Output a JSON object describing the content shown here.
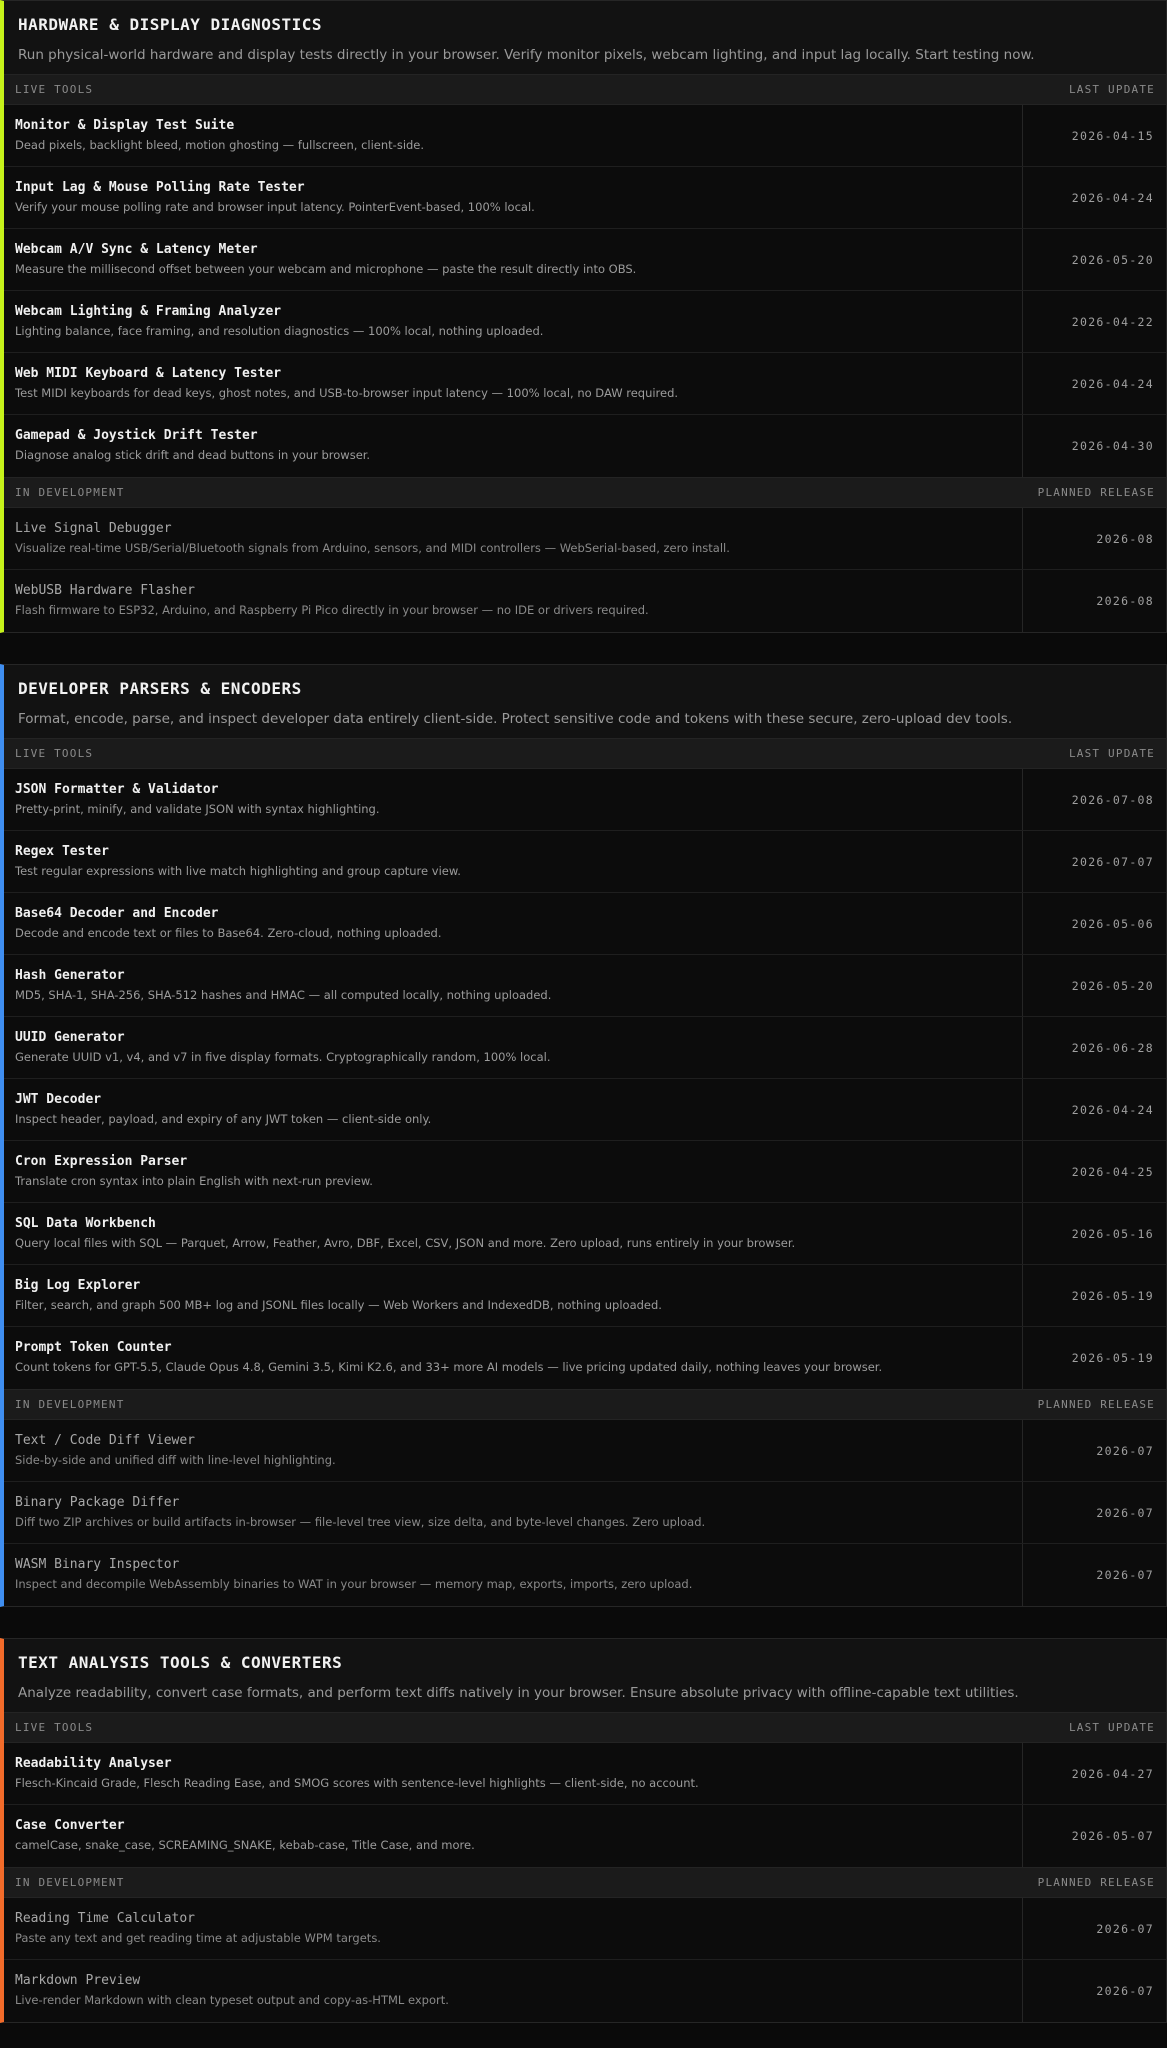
{
  "sections": [
    {
      "title": "HARDWARE & DISPLAY DIAGNOSTICS",
      "description": "Run physical-world hardware and display tests directly in your browser. Verify monitor pixels, webcam lighting, and input lag locally. Start testing now.",
      "accent": "#c6f21a",
      "live_header": {
        "left": "LIVE TOOLS",
        "right": "LAST UPDATE"
      },
      "live_tools": [
        {
          "name": "Monitor & Display Test Suite",
          "desc": "Dead pixels, backlight bleed, motion ghosting — fullscreen, client-side.",
          "date": "2026-04-15"
        },
        {
          "name": "Input Lag & Mouse Polling Rate Tester",
          "desc": "Verify your mouse polling rate and browser input latency. PointerEvent-based, 100% local.",
          "date": "2026-04-24"
        },
        {
          "name": "Webcam A/V Sync & Latency Meter",
          "desc": "Measure the millisecond offset between your webcam and microphone — paste the result directly into OBS.",
          "date": "2026-05-20"
        },
        {
          "name": "Webcam Lighting & Framing Analyzer",
          "desc": "Lighting balance, face framing, and resolution diagnostics — 100% local, nothing uploaded.",
          "date": "2026-04-22"
        },
        {
          "name": "Web MIDI Keyboard & Latency Tester",
          "desc": "Test MIDI keyboards for dead keys, ghost notes, and USB-to-browser input latency — 100% local, no DAW required.",
          "date": "2026-04-24"
        },
        {
          "name": "Gamepad & Joystick Drift Tester",
          "desc": "Diagnose analog stick drift and dead buttons in your browser.",
          "date": "2026-04-30"
        }
      ],
      "dev_header": {
        "left": "IN DEVELOPMENT",
        "right": "PLANNED RELEASE"
      },
      "dev_tools": [
        {
          "name": "Live Signal Debugger",
          "desc": "Visualize real-time USB/Serial/Bluetooth signals from Arduino, sensors, and MIDI controllers — WebSerial-based, zero install.",
          "date": "2026-08"
        },
        {
          "name": "WebUSB Hardware Flasher",
          "desc": "Flash firmware to ESP32, Arduino, and Raspberry Pi Pico directly in your browser — no IDE or drivers required.",
          "date": "2026-08"
        }
      ]
    },
    {
      "title": "DEVELOPER PARSERS & ENCODERS",
      "description": "Format, encode, parse, and inspect developer data entirely client-side. Protect sensitive code and tokens with these secure, zero-upload dev tools.",
      "accent": "#3f8ef0",
      "live_header": {
        "left": "LIVE TOOLS",
        "right": "LAST UPDATE"
      },
      "live_tools": [
        {
          "name": "JSON Formatter & Validator",
          "desc": "Pretty-print, minify, and validate JSON with syntax highlighting.",
          "date": "2026-07-08"
        },
        {
          "name": "Regex Tester",
          "desc": "Test regular expressions with live match highlighting and group capture view.",
          "date": "2026-07-07"
        },
        {
          "name": "Base64 Decoder and Encoder",
          "desc": "Decode and encode text or files to Base64. Zero-cloud, nothing uploaded.",
          "date": "2026-05-06"
        },
        {
          "name": "Hash Generator",
          "desc": "MD5, SHA-1, SHA-256, SHA-512 hashes and HMAC — all computed locally, nothing uploaded.",
          "date": "2026-05-20"
        },
        {
          "name": "UUID Generator",
          "desc": "Generate UUID v1, v4, and v7 in five display formats. Cryptographically random, 100% local.",
          "date": "2026-06-28"
        },
        {
          "name": "JWT Decoder",
          "desc": "Inspect header, payload, and expiry of any JWT token — client-side only.",
          "date": "2026-04-24"
        },
        {
          "name": "Cron Expression Parser",
          "desc": "Translate cron syntax into plain English with next-run preview.",
          "date": "2026-04-25"
        },
        {
          "name": "SQL Data Workbench",
          "desc": "Query local files with SQL — Parquet, Arrow, Feather, Avro, DBF, Excel, CSV, JSON and more. Zero upload, runs entirely in your browser.",
          "date": "2026-05-16"
        },
        {
          "name": "Big Log Explorer",
          "desc": "Filter, search, and graph 500 MB+ log and JSONL files locally — Web Workers and IndexedDB, nothing uploaded.",
          "date": "2026-05-19"
        },
        {
          "name": "Prompt Token Counter",
          "desc": "Count tokens for GPT-5.5, Claude Opus 4.8, Gemini 3.5, Kimi K2.6, and 33+ more AI models — live pricing updated daily, nothing leaves your browser.",
          "date": "2026-05-19"
        }
      ],
      "dev_header": {
        "left": "IN DEVELOPMENT",
        "right": "PLANNED RELEASE"
      },
      "dev_tools": [
        {
          "name": "Text / Code Diff Viewer",
          "desc": "Side-by-side and unified diff with line-level highlighting.",
          "date": "2026-07"
        },
        {
          "name": "Binary Package Differ",
          "desc": "Diff two ZIP archives or build artifacts in-browser — file-level tree view, size delta, and byte-level changes. Zero upload.",
          "date": "2026-07"
        },
        {
          "name": "WASM Binary Inspector",
          "desc": "Inspect and decompile WebAssembly binaries to WAT in your browser — memory map, exports, imports, zero upload.",
          "date": "2026-07"
        }
      ]
    },
    {
      "title": "TEXT ANALYSIS TOOLS & CONVERTERS",
      "description": "Analyze readability, convert case formats, and perform text diffs natively in your browser. Ensure absolute privacy with offline-capable text utilities.",
      "accent": "#f26b2a",
      "live_header": {
        "left": "LIVE TOOLS",
        "right": "LAST UPDATE"
      },
      "live_tools": [
        {
          "name": "Readability Analyser",
          "desc": "Flesch-Kincaid Grade, Flesch Reading Ease, and SMOG scores with sentence-level highlights — client-side, no account.",
          "date": "2026-04-27"
        },
        {
          "name": "Case Converter",
          "desc": "camelCase, snake_case, SCREAMING_SNAKE, kebab-case, Title Case, and more.",
          "date": "2026-05-07"
        }
      ],
      "dev_header": {
        "left": "IN DEVELOPMENT",
        "right": "PLANNED RELEASE"
      },
      "dev_tools": [
        {
          "name": "Reading Time Calculator",
          "desc": "Paste any text and get reading time at adjustable WPM targets.",
          "date": "2026-07"
        },
        {
          "name": "Markdown Preview",
          "desc": "Live-render Markdown with clean typeset output and copy-as-HTML export.",
          "date": "2026-07"
        }
      ]
    }
  ]
}
